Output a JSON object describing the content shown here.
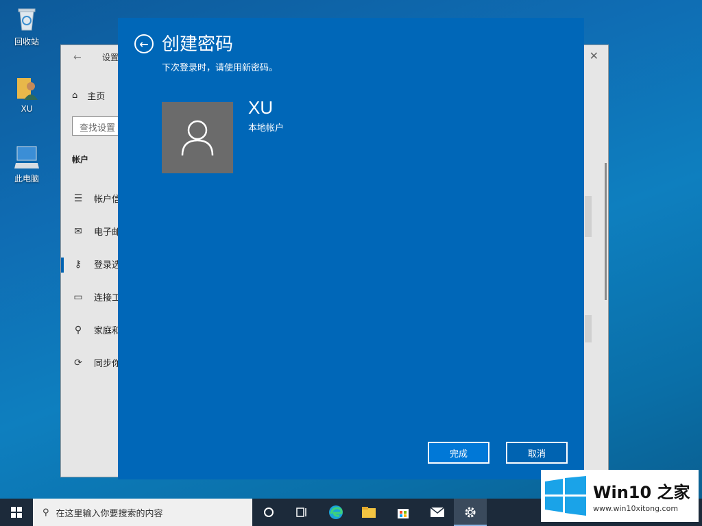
{
  "desktop": {
    "icons": [
      {
        "label": "回收站",
        "icon": "recycle-bin-icon"
      },
      {
        "label": "XU",
        "icon": "user-folder-icon"
      },
      {
        "label": "此电脑",
        "icon": "this-pc-icon"
      }
    ]
  },
  "settings_window": {
    "title": "设置",
    "home_label": "主页",
    "search_placeholder": "查找设置",
    "section_label": "帐户",
    "nav_items": [
      {
        "label": "帐户信",
        "icon": "person-card-icon"
      },
      {
        "label": "电子邮",
        "icon": "mail-icon"
      },
      {
        "label": "登录选",
        "icon": "key-icon"
      },
      {
        "label": "连接工",
        "icon": "briefcase-icon"
      },
      {
        "label": "家庭和",
        "icon": "person-add-icon"
      },
      {
        "label": "同步你",
        "icon": "sync-icon"
      }
    ]
  },
  "dialog": {
    "title": "创建密码",
    "subtitle": "下次登录时，请使用新密码。",
    "user_name": "XU",
    "account_type": "本地帐户",
    "finish_label": "完成",
    "cancel_label": "取消",
    "accent_color": "#0067b8"
  },
  "taskbar": {
    "search_placeholder": "在这里输入你要搜索的内容",
    "pinned": [
      "cortana-icon",
      "task-view-icon",
      "edge-icon",
      "file-explorer-icon",
      "store-icon",
      "mail-icon",
      "settings-gear-icon"
    ]
  },
  "watermark": {
    "name": "Win10 之家",
    "url": "www.win10xitong.com"
  }
}
